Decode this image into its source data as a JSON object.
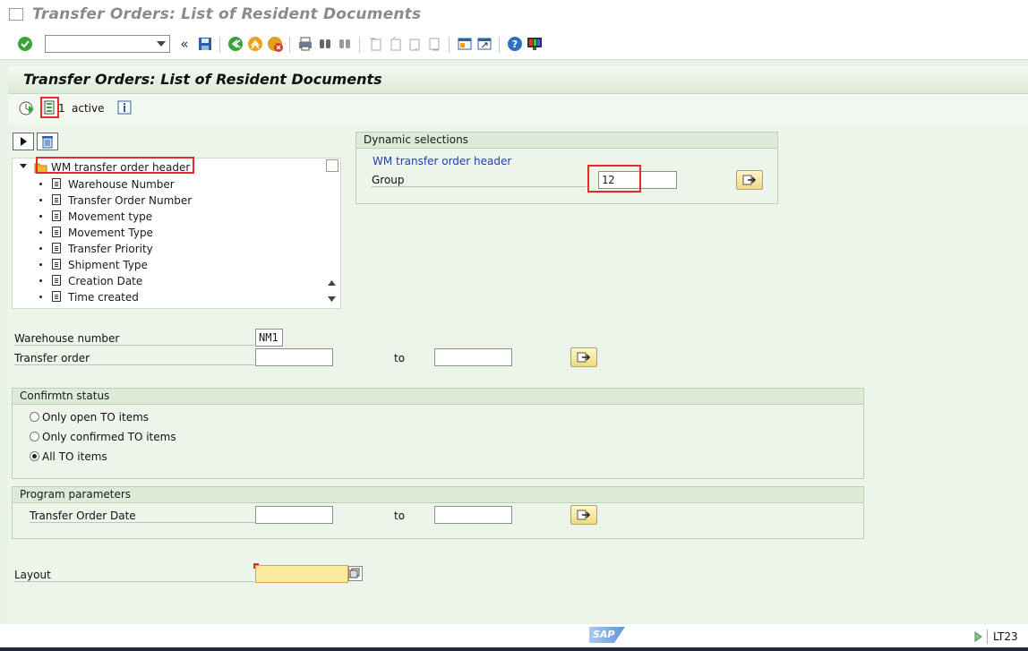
{
  "window": {
    "title": "Transfer Orders: List of Resident Documents"
  },
  "toolbar": {
    "command_value": "",
    "icons": [
      "enter-icon",
      "back-double-icon",
      "save-icon",
      "back-icon",
      "exit-icon",
      "cancel-icon",
      "print-icon",
      "find-icon",
      "find-next-icon",
      "first-page-icon",
      "previous-page-icon",
      "next-page-icon",
      "last-page-icon",
      "new-session-icon",
      "shortcut-icon",
      "help-icon",
      "customize-layout-icon"
    ]
  },
  "page": {
    "title": "Transfer Orders: List of Resident Documents"
  },
  "apptoolbar": {
    "active_count": "1",
    "active_label": "active"
  },
  "tree": {
    "root": "WM transfer order header",
    "items": [
      "Warehouse Number",
      "Transfer Order Number",
      "Movement type",
      "Movement Type",
      "Transfer Priority",
      "Shipment Type",
      "Creation Date",
      "Time created"
    ]
  },
  "dynamic": {
    "title": "Dynamic selections",
    "subheading": "WM transfer order header",
    "group_label": "Group",
    "group_value": "12"
  },
  "fields": {
    "warehouse_label": "Warehouse number",
    "warehouse_value": "NM1",
    "to_label": "Transfer order",
    "to_from": "",
    "to_to": "",
    "to_word": "to"
  },
  "confirm": {
    "title": "Confirmtn status",
    "options": [
      "Only open TO items",
      "Only confirmed TO items",
      "All TO items"
    ],
    "selected": 2
  },
  "params": {
    "title": "Program parameters",
    "date_label": "Transfer Order Date",
    "to_word": "to",
    "from": "",
    "to": ""
  },
  "layout": {
    "label": "Layout",
    "value": ""
  },
  "status": {
    "tcode": "LT23",
    "logo": "SAP"
  },
  "colors": {
    "accent_red": "#e32b2b",
    "bg_green": "#edf5ea",
    "link_blue": "#1a3fb5"
  }
}
